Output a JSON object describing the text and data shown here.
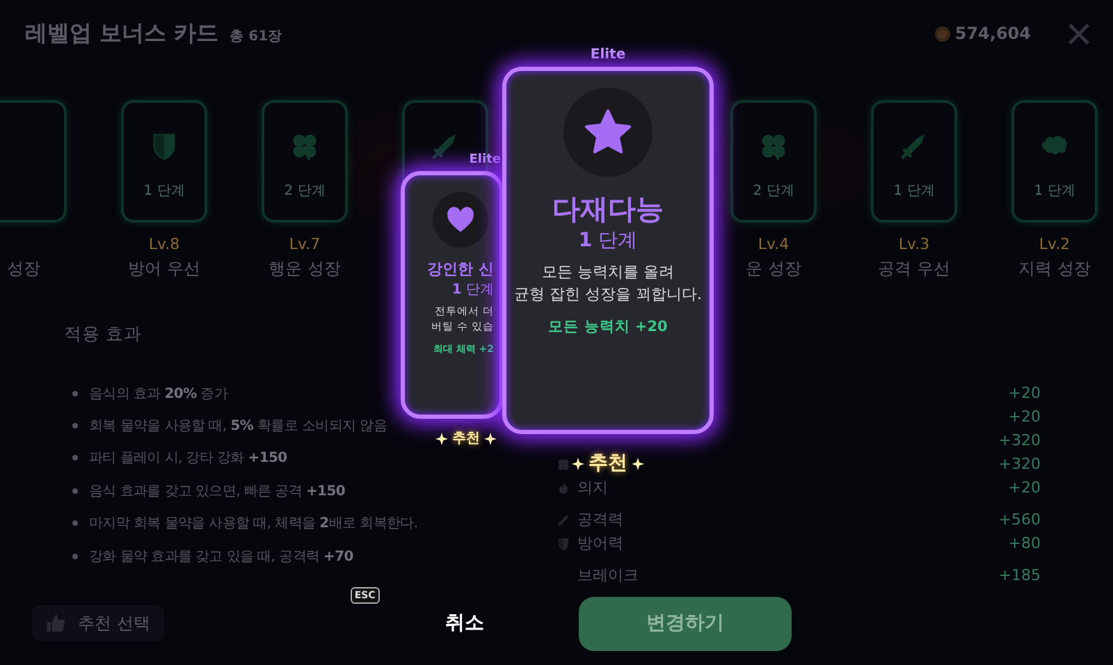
{
  "header": {
    "title": "레벨업 보너스 카드",
    "count": "총 61장",
    "coins": "574,604"
  },
  "cards": [
    {
      "name": "성장"
    },
    {
      "kind": "defense",
      "stage": "1 단계",
      "level": "Lv.8",
      "name": "방어 우선"
    },
    {
      "kind": "luck",
      "stage": "2 단계",
      "level": "Lv.7",
      "name": "행운 성장"
    },
    {
      "kind": "attack"
    },
    {
      "kind": "luck",
      "stage": "2 단계",
      "level": "Lv.4",
      "name": "운 성장"
    },
    {
      "kind": "attack",
      "stage": "1 단계",
      "level": "Lv.3",
      "name": "공격 우선"
    },
    {
      "kind": "brain",
      "stage": "1 단계",
      "level": "Lv.2",
      "name": "지력 성장"
    }
  ],
  "effects": {
    "title": "적용 효과",
    "items": [
      "음식의 효과 **20%** 증가",
      "회복 물약을 사용할 때, **5%** 확률로 소비되지 않음",
      "파티 플레이 시, 강타 강화 **+150**",
      "음식 효과를 갖고 있으면, 빠른 공격 **+150**",
      "마지막 회복 물약을 사용할 때, 체력을 **2**배로 회복한다.",
      "강화 물약 효과를 갖고 있을 때, 공격력 **+70**"
    ]
  },
  "stats": [
    {
      "value": "+20"
    },
    {
      "value": "+20"
    },
    {
      "value": "+320"
    },
    {
      "kind": "luck",
      "value": "+320"
    },
    {
      "kind": "will",
      "label": "의지",
      "value": "+20"
    },
    {
      "kind": "attack",
      "label": "공격력",
      "value": "+560"
    },
    {
      "kind": "defense",
      "label": "방어력",
      "value": "+80"
    },
    {
      "label": "브레이크",
      "value": "+185"
    }
  ],
  "offers": [
    {
      "kind": "heart",
      "selected": false,
      "tier": "Elite",
      "title": "강인한 신",
      "stage": "**1** 단계",
      "description": "전투에서 더\n버틸 수 있습",
      "bonus": "최대 체력 +2",
      "badge": "추천"
    },
    {
      "kind": "star",
      "selected": true,
      "tier": "Elite",
      "title": "다재다능",
      "stage": "**1** 단계",
      "description": "모든 능력치를 올려\n균형 잡힌 성장을 꾀합니다.",
      "bonus": "모든 능력치 +20",
      "badge": "추천"
    }
  ],
  "footer": {
    "recommend": "추천 선택",
    "cancel": "취소",
    "cancel_key": "ESC",
    "confirm": "변경하기"
  }
}
